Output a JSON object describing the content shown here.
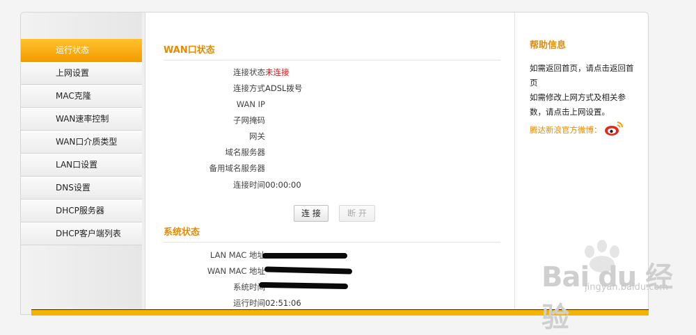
{
  "menu": [
    {
      "label": "运行状态",
      "active": true
    },
    {
      "label": "上网设置"
    },
    {
      "label": "MAC克隆"
    },
    {
      "label": "WAN速率控制"
    },
    {
      "label": "WAN口介质类型"
    },
    {
      "label": "LAN口设置"
    },
    {
      "label": "DNS设置"
    },
    {
      "label": "DHCP服务器"
    },
    {
      "label": "DHCP客户端列表"
    }
  ],
  "wan": {
    "title": "WAN口状态",
    "rows": [
      {
        "label": "连接状态",
        "value": "未连接"
      },
      {
        "label": "连接方式",
        "value": "ADSL拨号"
      },
      {
        "label": "WAN IP",
        "value": ""
      },
      {
        "label": "子网掩码",
        "value": ""
      },
      {
        "label": "网关",
        "value": ""
      },
      {
        "label": "域名服务器",
        "value": ""
      },
      {
        "label": "备用域名服务器",
        "value": ""
      },
      {
        "label": "连接时间",
        "value": "00:00:00"
      }
    ],
    "connect_button": "连 接",
    "disconnect_button": "断 开"
  },
  "system": {
    "title": "系统状态",
    "rows": [
      {
        "label": "LAN MAC 地址",
        "value": ""
      },
      {
        "label": "WAN MAC 地址",
        "value": ""
      },
      {
        "label": "系统时间",
        "value": ""
      },
      {
        "label": "运行时间",
        "value": "02:51:06"
      }
    ]
  },
  "help": {
    "title": "帮助信息",
    "text1": "如需返回首页，请点击返回首页",
    "text2": "如需修改上网方式及相关参数，请点击上网设置。",
    "weibo_label": "腾达新浪官方微博："
  },
  "watermark": {
    "text": "Bai du 经验",
    "sub": "jingyan.baidu.com"
  },
  "colors": {
    "accent": "#e38b00",
    "active_menu": "#f7a400",
    "status_red": "#c81d1d"
  }
}
